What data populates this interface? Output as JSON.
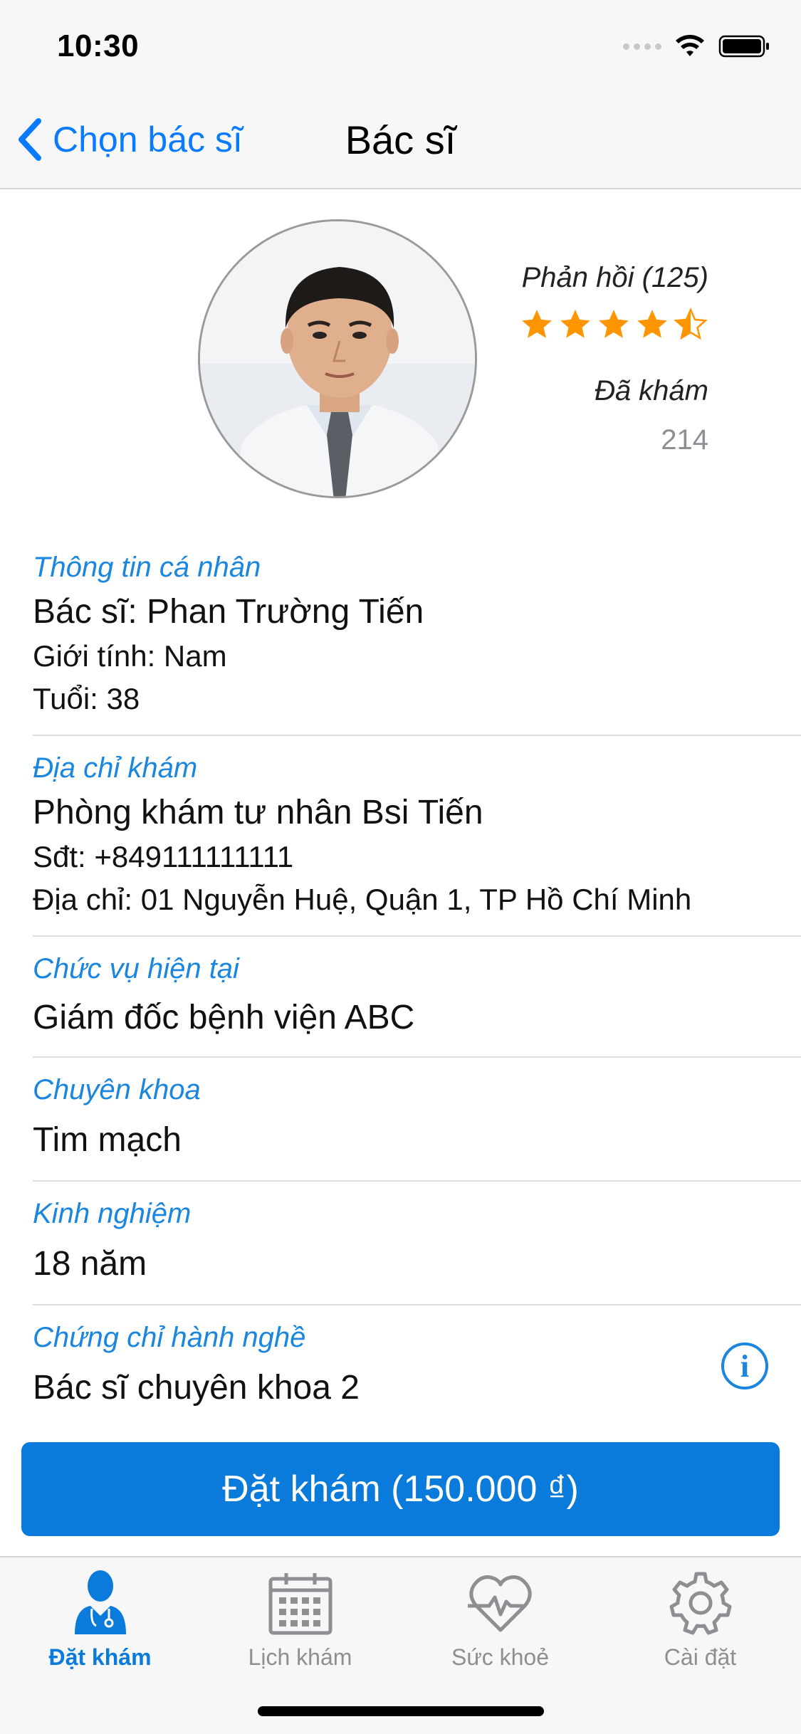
{
  "status_bar": {
    "time": "10:30"
  },
  "nav": {
    "back_label": "Chọn bác sĩ",
    "title": "Bác sĩ"
  },
  "profile": {
    "feedback_label": "Phản hồi (125)",
    "rating": 4.5,
    "examined_label": "Đã khám",
    "examined_count": "214"
  },
  "sections": {
    "personal": {
      "header": "Thông tin cá nhân",
      "name": "Bác sĩ: Phan Trường Tiến",
      "gender": "Giới tính: Nam",
      "age": "Tuổi: 38"
    },
    "address": {
      "header": "Địa chỉ khám",
      "clinic": "Phòng khám tư nhân Bsi Tiến",
      "phone": "Sđt: +849111111111",
      "address": "Địa chỉ: 01 Nguyễn Huệ, Quận 1, TP Hồ Chí Minh"
    },
    "position": {
      "header": "Chức vụ hiện tại",
      "value": "Giám đốc bệnh viện ABC"
    },
    "specialty": {
      "header": "Chuyên khoa",
      "value": "Tim mạch"
    },
    "experience": {
      "header": "Kinh nghiệm",
      "value": "18 năm"
    },
    "license": {
      "header": "Chứng chỉ hành nghề",
      "value": "Bác sĩ chuyên khoa 2",
      "info_icon": "i"
    }
  },
  "book_button": {
    "label": "Đặt khám (150.000 ₫)"
  },
  "tabs": [
    {
      "label": "Đặt khám",
      "icon": "doctor-icon",
      "active": true
    },
    {
      "label": "Lịch khám",
      "icon": "calendar-icon",
      "active": false
    },
    {
      "label": "Sức khoẻ",
      "icon": "heart-pulse-icon",
      "active": false
    },
    {
      "label": "Cài đặt",
      "icon": "gear-icon",
      "active": false
    }
  ],
  "colors": {
    "accent": "#0a7bdb",
    "header_text": "#1a86e0",
    "star": "#ff9500",
    "inactive": "#8e8e93"
  }
}
